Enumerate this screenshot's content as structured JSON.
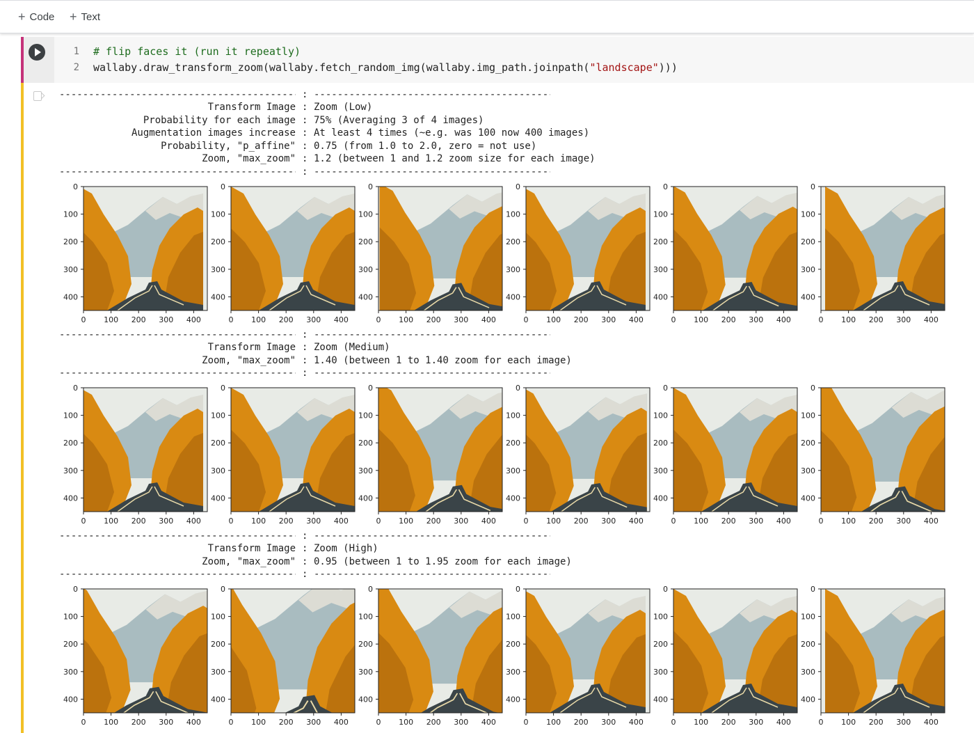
{
  "toolbar": {
    "code_label": "Code",
    "text_label": "Text"
  },
  "cell": {
    "line_numbers": [
      "1",
      "2"
    ],
    "line1": "# flip faces it (run it repeatly)",
    "line2_pre": "wallaby.draw_transform_zoom(wallaby.fetch_random_img(wallaby.img_path.joinpath(",
    "line2_str": "\"landscape\"",
    "line2_post": ")))"
  },
  "output": {
    "separator_left": "-----------------------------------------------",
    "separator_right": "-----------------------------------------------",
    "colon": ":",
    "section_low": [
      {
        "key": "Transform Image",
        "value": "Zoom (Low)"
      },
      {
        "key": "Probability for each image",
        "value": "75% (Averaging 3 of 4 images)"
      },
      {
        "key": "Augmentation images increase",
        "value": "At least 4 times (~e.g. was 100 now 400 images)"
      },
      {
        "key": "Probability, \"p_affine\"",
        "value": "0.75 (from 1.0 to 2.0, zero = not use)"
      },
      {
        "key": "Zoom, \"max_zoom\"",
        "value": "1.2 (between 1 and 1.2 zoom size for each image)"
      }
    ],
    "section_medium": [
      {
        "key": "Transform Image",
        "value": "Zoom (Medium)"
      },
      {
        "key": "Zoom, \"max_zoom\"",
        "value": "1.40 (between 1 to 1.40 zoom for each image)"
      }
    ],
    "section_high": [
      {
        "key": "Transform Image",
        "value": "Zoom (High)"
      },
      {
        "key": "Zoom, \"max_zoom\"",
        "value": "0.95 (between 1 to 1.95 zoom for each image)"
      }
    ]
  },
  "plots": {
    "x_ticks": [
      "0",
      "100",
      "200",
      "300",
      "400"
    ],
    "y_ticks": [
      "0",
      "100",
      "200",
      "300",
      "400"
    ],
    "image_content": "autumn landscape: orange trees, mountains, winding road",
    "colors": {
      "sky": "#e8ebe6",
      "mountain": "#a9bcc0",
      "snow": "#dcdcd4",
      "foliage": "#d98a12",
      "foliage_dark": "#a35f0a",
      "road": "#3a4448"
    }
  }
}
